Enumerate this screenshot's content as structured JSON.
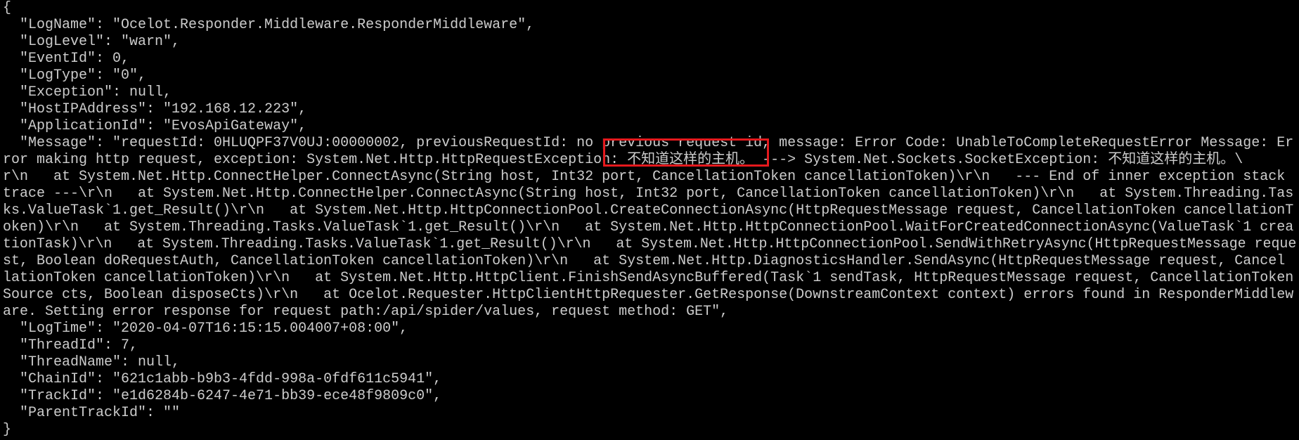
{
  "console": {
    "lines": [
      "{",
      "  \"LogName\": \"Ocelot.Responder.Middleware.ResponderMiddleware\",",
      "  \"LogLevel\": \"warn\",",
      "  \"EventId\": 0,",
      "  \"LogType\": \"0\",",
      "  \"Exception\": null,",
      "  \"HostIPAddress\": \"192.168.12.223\",",
      "  \"ApplicationId\": \"EvosApiGateway\",",
      "  \"Message\": \"requestId: 0HLUQPF37V0UJ:00000002, previousRequestId: no previous request id, message: Error Code: UnableToCompleteRequestError Message: Er",
      "ror making http request, exception: System.Net.Http.HttpRequestException: 不知道这样的主机。 ---> System.Net.Sockets.SocketException: 不知道这样的主机。\\",
      "r\\n   at System.Net.Http.ConnectHelper.ConnectAsync(String host, Int32 port, CancellationToken cancellationToken)\\r\\n   --- End of inner exception stack",
      "trace ---\\r\\n   at System.Net.Http.ConnectHelper.ConnectAsync(String host, Int32 port, CancellationToken cancellationToken)\\r\\n   at System.Threading.Tas",
      "ks.ValueTask`1.get_Result()\\r\\n   at System.Net.Http.HttpConnectionPool.CreateConnectionAsync(HttpRequestMessage request, CancellationToken cancellationT",
      "oken)\\r\\n   at System.Threading.Tasks.ValueTask`1.get_Result()\\r\\n   at System.Net.Http.HttpConnectionPool.WaitForCreatedConnectionAsync(ValueTask`1 crea",
      "tionTask)\\r\\n   at System.Threading.Tasks.ValueTask`1.get_Result()\\r\\n   at System.Net.Http.HttpConnectionPool.SendWithRetryAsync(HttpRequestMessage reque",
      "st, Boolean doRequestAuth, CancellationToken cancellationToken)\\r\\n   at System.Net.Http.DiagnosticsHandler.SendAsync(HttpRequestMessage request, Cancel",
      "lationToken cancellationToken)\\r\\n   at System.Net.Http.HttpClient.FinishSendAsyncBuffered(Task`1 sendTask, HttpRequestMessage request, CancellationToken",
      "Source cts, Boolean disposeCts)\\r\\n   at Ocelot.Requester.HttpClientHttpRequester.GetResponse(DownstreamContext context) errors found in ResponderMiddlew",
      "are. Setting error response for request path:/api/spider/values, request method: GET\",",
      "  \"LogTime\": \"2020-04-07T16:15:15.004007+08:00\",",
      "  \"ThreadId\": 7,",
      "  \"ThreadName\": null,",
      "  \"ChainId\": \"621c1abb-b9b3-4fdd-998a-0fdf611c5941\",",
      "  \"TrackId\": \"e1d6284b-6247-4e71-bb39-ece48f9809c0\",",
      "  \"ParentTrackId\": \"\"",
      "}"
    ]
  },
  "colors": {
    "background": "#000000",
    "text": "#cccccc",
    "highlight_border": "#e5191d"
  }
}
